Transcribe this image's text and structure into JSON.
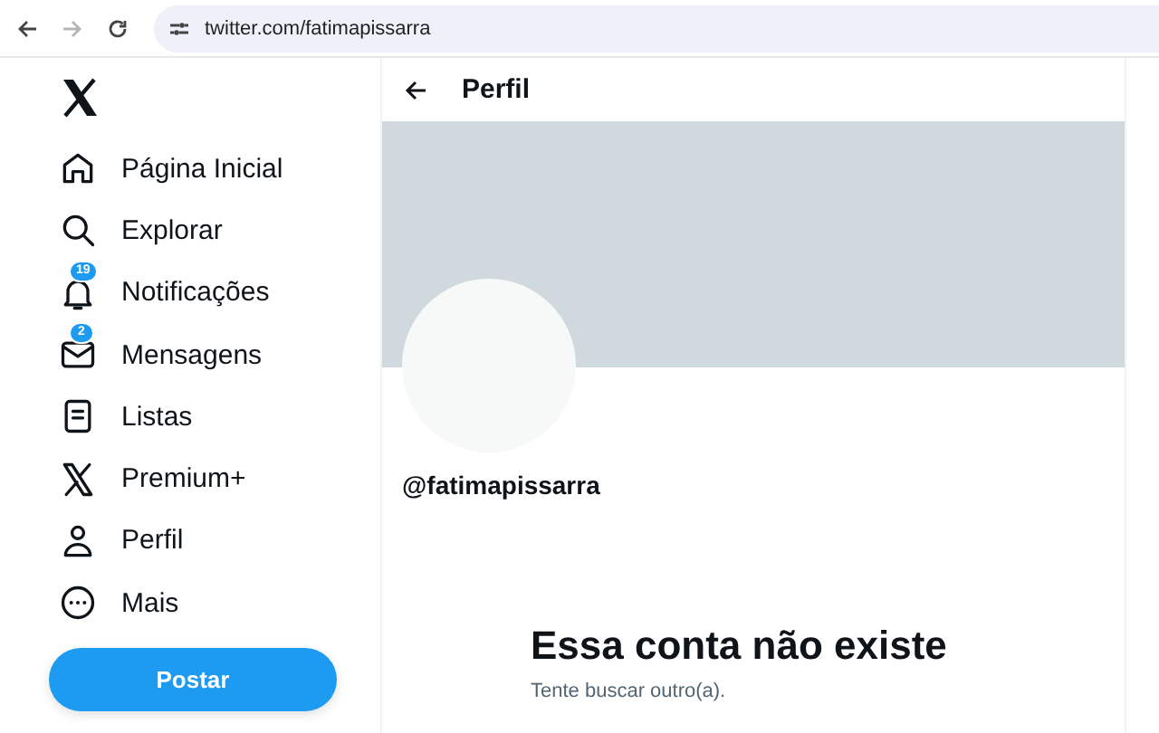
{
  "browser": {
    "url": "twitter.com/fatimapissarra"
  },
  "sidebar": {
    "items": [
      {
        "label": "Página Inicial"
      },
      {
        "label": "Explorar"
      },
      {
        "label": "Notificações",
        "badge": "19"
      },
      {
        "label": "Mensagens",
        "badge": "2"
      },
      {
        "label": "Listas"
      },
      {
        "label": "Premium+"
      },
      {
        "label": "Perfil"
      },
      {
        "label": "Mais"
      }
    ],
    "post_button": "Postar"
  },
  "profile": {
    "header_title": "Perfil",
    "handle": "@fatimapissarra",
    "empty_title": "Essa conta não existe",
    "empty_subtitle": "Tente buscar outro(a)."
  }
}
